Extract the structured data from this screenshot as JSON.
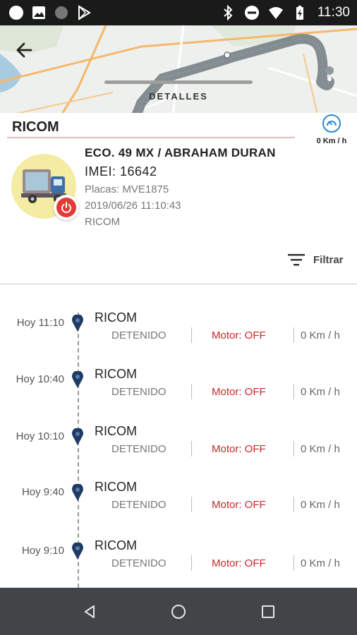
{
  "status_bar": {
    "time": "11:30",
    "icons": [
      "circle-icon",
      "image-icon",
      "circle-dark-icon",
      "play-store-icon",
      "bluetooth-icon",
      "do-not-disturb-icon",
      "wifi-icon",
      "battery-icon"
    ]
  },
  "map": {
    "section_label": "DETALLES"
  },
  "header": {
    "title": "RICOM",
    "speed": "0 Km / h"
  },
  "vehicle": {
    "name": "ECO. 49 MX / ABRAHAM DURAN",
    "imei": "IMEI: 16642",
    "plates": "Placas: MVE1875",
    "datetime": "2019/06/26 11:10:43",
    "company": "RICOM"
  },
  "filter": {
    "label": "Filtrar"
  },
  "events": [
    {
      "time": "Hoy 11:10",
      "title": "RICOM",
      "status": "DETENIDO",
      "motor": "Motor: OFF",
      "speed": "0 Km / h"
    },
    {
      "time": "Hoy 10:40",
      "title": "RICOM",
      "status": "DETENIDO",
      "motor": "Motor: OFF",
      "speed": "0 Km / h"
    },
    {
      "time": "Hoy 10:10",
      "title": "RICOM",
      "status": "DETENIDO",
      "motor": "Motor: OFF",
      "speed": "0 Km / h"
    },
    {
      "time": "Hoy 9:40",
      "title": "RICOM",
      "status": "DETENIDO",
      "motor": "Motor: OFF",
      "speed": "0 Km / h"
    },
    {
      "time": "Hoy 9:10",
      "title": "RICOM",
      "status": "DETENIDO",
      "motor": "Motor: OFF",
      "speed": "0 Km / h"
    }
  ],
  "colors": {
    "motor_off": "#c62828",
    "pin": "#1f3b63",
    "route": "#6e7a80",
    "avatar_bg": "#f4eca2",
    "power": "#e53935"
  }
}
